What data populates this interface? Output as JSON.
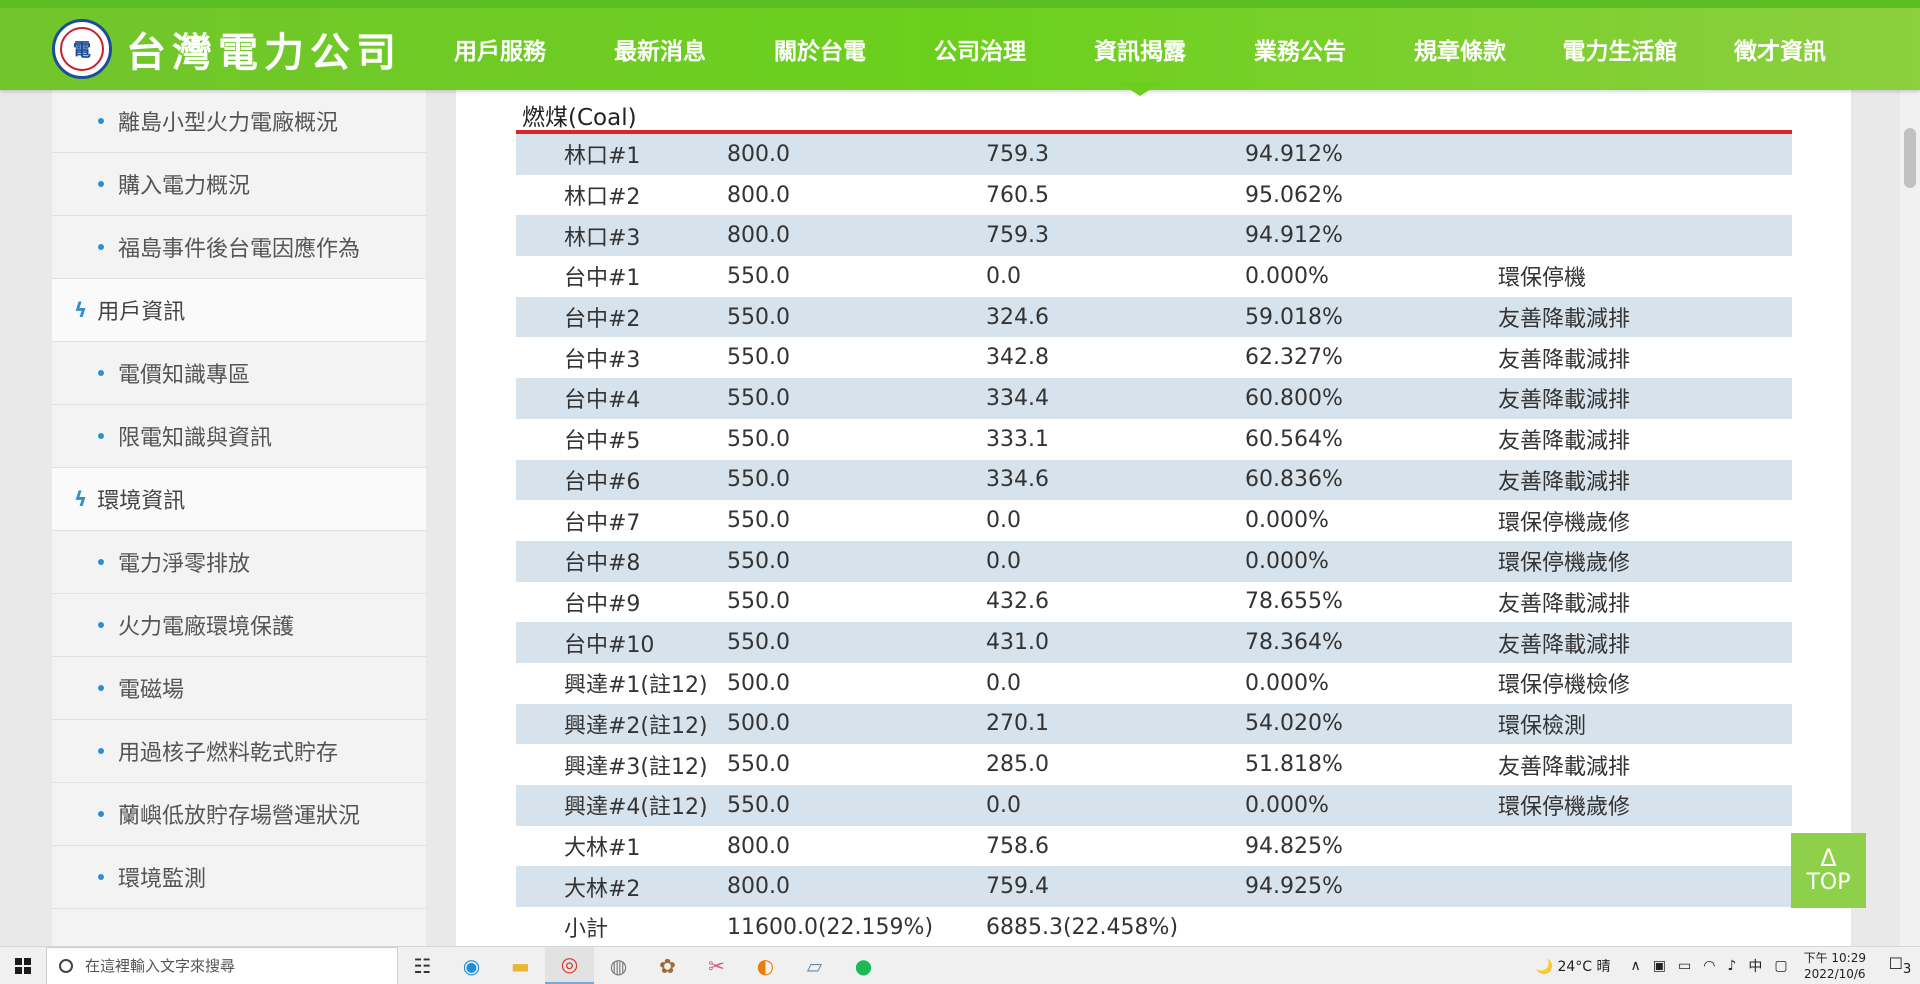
{
  "header": {
    "logo_text": "台灣電力公司",
    "nav": [
      "用戶服務",
      "最新消息",
      "關於台電",
      "公司治理",
      "資訊揭露",
      "業務公告",
      "規章條款",
      "電力生活館",
      "徵才資訊"
    ],
    "active_nav": "資訊揭露"
  },
  "sidebar": {
    "items": [
      {
        "type": "sub",
        "label": "離島小型火力電廠概況"
      },
      {
        "type": "sub",
        "label": "購入電力概況"
      },
      {
        "type": "sub",
        "label": "福島事件後台電因應作為"
      },
      {
        "type": "head",
        "label": "用戶資訊"
      },
      {
        "type": "sub",
        "label": "電價知識專區"
      },
      {
        "type": "sub",
        "label": "限電知識與資訊"
      },
      {
        "type": "head",
        "label": "環境資訊"
      },
      {
        "type": "sub",
        "label": "電力淨零排放"
      },
      {
        "type": "sub",
        "label": "火力電廠環境保護"
      },
      {
        "type": "sub",
        "label": "電磁場"
      },
      {
        "type": "sub",
        "label": "用過核子燃料乾式貯存"
      },
      {
        "type": "sub",
        "label": "蘭嶼低放貯存場營運狀況"
      },
      {
        "type": "sub",
        "label": "環境監測"
      }
    ]
  },
  "main": {
    "section_title": "燃煤(Coal)",
    "rows": [
      [
        "林口#1",
        "800.0",
        "759.3",
        "94.912%",
        ""
      ],
      [
        "林口#2",
        "800.0",
        "760.5",
        "95.062%",
        ""
      ],
      [
        "林口#3",
        "800.0",
        "759.3",
        "94.912%",
        ""
      ],
      [
        "台中#1",
        "550.0",
        "0.0",
        "0.000%",
        "環保停機"
      ],
      [
        "台中#2",
        "550.0",
        "324.6",
        "59.018%",
        "友善降載減排"
      ],
      [
        "台中#3",
        "550.0",
        "342.8",
        "62.327%",
        "友善降載減排"
      ],
      [
        "台中#4",
        "550.0",
        "334.4",
        "60.800%",
        "友善降載減排"
      ],
      [
        "台中#5",
        "550.0",
        "333.1",
        "60.564%",
        "友善降載減排"
      ],
      [
        "台中#6",
        "550.0",
        "334.6",
        "60.836%",
        "友善降載減排"
      ],
      [
        "台中#7",
        "550.0",
        "0.0",
        "0.000%",
        "環保停機歲修"
      ],
      [
        "台中#8",
        "550.0",
        "0.0",
        "0.000%",
        "環保停機歲修"
      ],
      [
        "台中#9",
        "550.0",
        "432.6",
        "78.655%",
        "友善降載減排"
      ],
      [
        "台中#10",
        "550.0",
        "431.0",
        "78.364%",
        "友善降載減排"
      ],
      [
        "興達#1(註12)",
        "500.0",
        "0.0",
        "0.000%",
        "環保停機檢修"
      ],
      [
        "興達#2(註12)",
        "500.0",
        "270.1",
        "54.020%",
        "環保檢測"
      ],
      [
        "興達#3(註12)",
        "550.0",
        "285.0",
        "51.818%",
        "友善降載減排"
      ],
      [
        "興達#4(註12)",
        "550.0",
        "0.0",
        "0.000%",
        "環保停機歲修"
      ],
      [
        "大林#1",
        "800.0",
        "758.6",
        "94.825%",
        ""
      ],
      [
        "大林#2",
        "800.0",
        "759.4",
        "94.925%",
        ""
      ]
    ],
    "subtotal": [
      "小計",
      "11600.0(22.159%)",
      "6885.3(22.458%)",
      "",
      ""
    ]
  },
  "top_button": {
    "arrow": "Δ",
    "label": "TOP"
  },
  "taskbar": {
    "search_placeholder": "在這裡輸入文字來搜尋",
    "weather": "24°C 晴",
    "ime": "中",
    "time": "下午 10:29",
    "date": "2022/10/6",
    "notifications": "3"
  }
}
